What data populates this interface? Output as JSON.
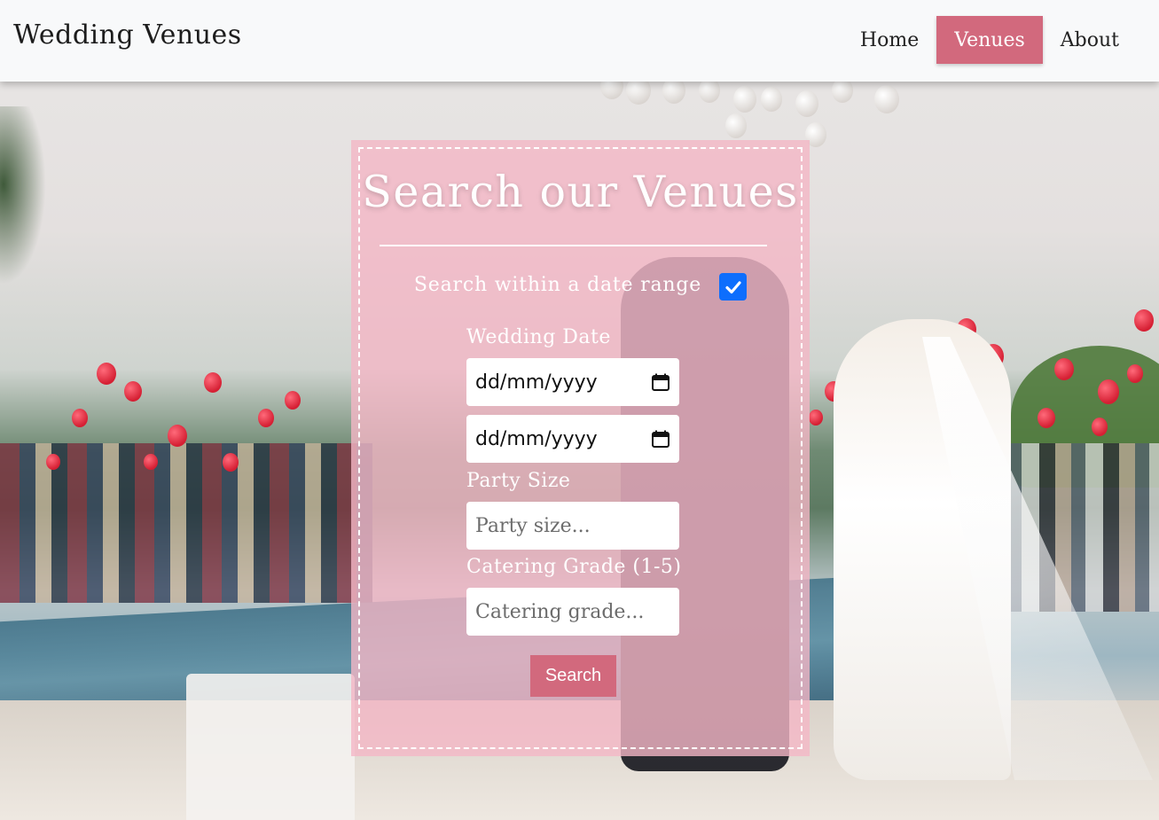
{
  "navbar": {
    "brand": "Wedding Venues",
    "items": [
      {
        "label": "Home",
        "active": false
      },
      {
        "label": "Venues",
        "active": true
      },
      {
        "label": "About",
        "active": false
      }
    ]
  },
  "search": {
    "title": "Search our Venues",
    "date_range_label": "Search within a date range",
    "date_range_checked": true,
    "wedding_date_label": "Wedding Date",
    "date_from_value": "dd/mm/yyyy",
    "date_to_value": "dd/mm/yyyy",
    "party_size_label": "Party Size",
    "party_size_placeholder": "Party size...",
    "catering_label": "Catering Grade (1-5)",
    "catering_placeholder": "Catering grade...",
    "button_label": "Search"
  },
  "colors": {
    "accent": "#d2697d",
    "card_bg": "#f4b7c6",
    "checkbox": "#0d6efd",
    "navbar_bg": "#f8f9fa"
  },
  "icons": {
    "calendar": "calendar-icon",
    "check": "check-icon"
  }
}
